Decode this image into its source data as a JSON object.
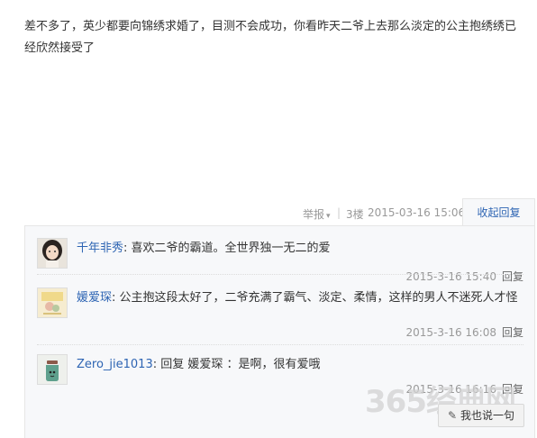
{
  "post": {
    "text": "差不多了，英少都要向锦绣求婚了，目测不会成功，你看昨天二爷上去那么淡定的公主抱绣绣已经欣然接受了",
    "report_label": "举报",
    "report_caret": "▾",
    "separator": "|",
    "floor": "3楼",
    "date": "2015-03-16 15:06",
    "collapse_label": "收起回复"
  },
  "replies": [
    {
      "user": "千年非秀",
      "colon": ":",
      "text": " 喜欢二爷的霸道。全世界独一无二的爱",
      "time": "2015-3-16 15:40",
      "reply_label": "回复",
      "avatar_icon": "girl-avatar-icon"
    },
    {
      "user": "媛爱琛",
      "colon": ":",
      "text": " 公主抱这段太好了，二爷充满了霸气、淡定、柔情，这样的男人不迷死人才怪",
      "time": "2015-3-16 16:08",
      "reply_label": "回复",
      "avatar_icon": "illustration-avatar-icon"
    },
    {
      "user": "Zero_jie1013",
      "colon": ":",
      "text": " 回复 媛爱琛 ：是啊，很有爱哦",
      "time": "2015-3-16 16:16",
      "reply_label": "回复",
      "avatar_icon": "jar-avatar-icon"
    }
  ],
  "watermark": "365经典网",
  "say_button": {
    "pen": "✎",
    "label": "我也说一句"
  },
  "colors": {
    "link": "#2d64b3",
    "meta": "#999999",
    "reply_bg": "#f7f8fa"
  }
}
